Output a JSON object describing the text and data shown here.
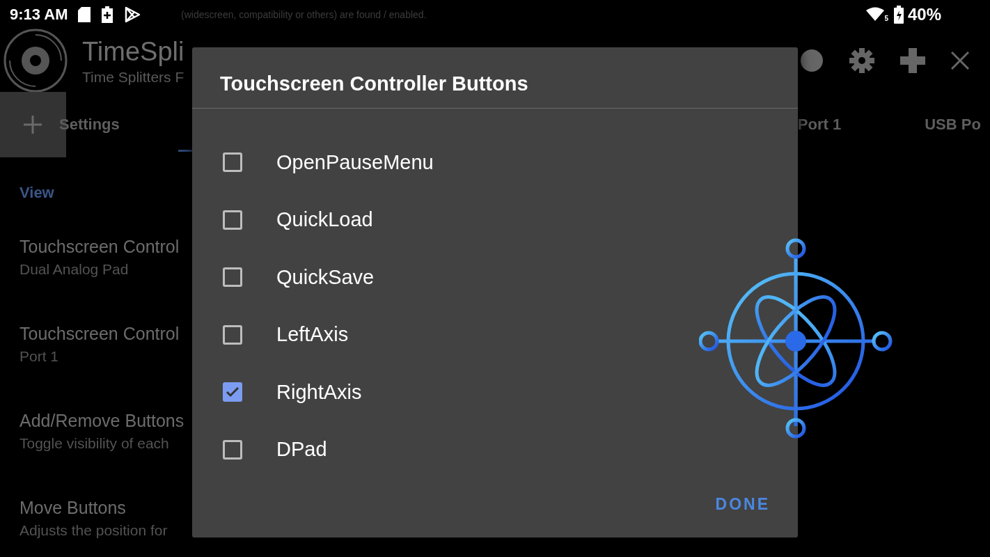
{
  "status_bar": {
    "time": "9:13 AM",
    "battery": "40%",
    "wifi_badge": "5"
  },
  "toast": {
    "text": "(widescreen, compatibility or others) are found / enabled."
  },
  "app_bar": {
    "title": "TimeSpli",
    "subtitle": "Time Splitters F"
  },
  "tabs": [
    {
      "label": "Settings"
    },
    {
      "label": "Port 1"
    },
    {
      "label": "USB Po"
    }
  ],
  "settings": {
    "header": "View",
    "items": [
      {
        "title": "Touchscreen Control",
        "summary": "Dual Analog Pad"
      },
      {
        "title": "Touchscreen Control",
        "summary": "Port 1"
      },
      {
        "title": "Add/Remove Buttons",
        "summary": "Toggle visibility of each"
      },
      {
        "title": "Move Buttons",
        "summary": "Adjusts the position for"
      }
    ]
  },
  "dialog": {
    "title": "Touchscreen Controller Buttons",
    "options": [
      {
        "label": "OpenPauseMenu",
        "checked": false
      },
      {
        "label": "QuickLoad",
        "checked": false
      },
      {
        "label": "QuickSave",
        "checked": false
      },
      {
        "label": "LeftAxis",
        "checked": false
      },
      {
        "label": "RightAxis",
        "checked": true
      },
      {
        "label": "DPad",
        "checked": false
      }
    ],
    "button": "DONE"
  }
}
